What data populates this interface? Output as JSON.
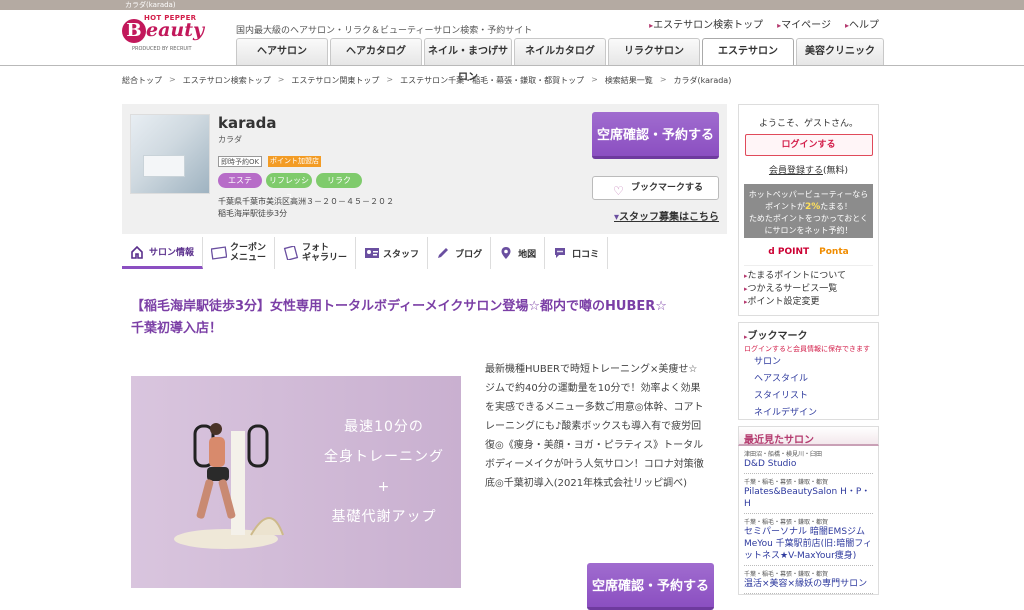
{
  "browser": {
    "title": "カラダ(karada)"
  },
  "logo": {
    "top": "HOT PEPPER",
    "main": "Beauty",
    "produced": "PRODUCED BY RECRUIT"
  },
  "header": {
    "tagline": "国内最大級のヘアサロン・リラク＆ビューティーサロン検索・予約サイト",
    "links": [
      "エステサロン検索トップ",
      "マイページ",
      "ヘルプ"
    ]
  },
  "nav": {
    "tabs": [
      "ヘアサロン",
      "ヘアカタログ",
      "ネイル・まつげサロン",
      "ネイルカタログ",
      "リラクサロン",
      "エステサロン",
      "美容クリニック"
    ],
    "active": "エステサロン"
  },
  "breadcrumb": [
    "総合トップ",
    "エステサロン検索トップ",
    "エステサロン関東トップ",
    "エステサロン千葉・稲毛・幕張・鎌取・都賀トップ",
    "検索結果一覧",
    "カラダ(karada)"
  ],
  "salon": {
    "name": "karada",
    "kana": "カラダ",
    "badges": [
      "即時予約OK",
      "ポイント加盟店"
    ],
    "genres": [
      "エステ",
      "リフレッシュ",
      "リラク"
    ],
    "address": "千葉県千葉市美浜区高洲３－２０－４５－２０２",
    "access": "稲毛海岸駅徒歩3分",
    "reserve_label": "空席確認・予約する",
    "bookmark_label": "ブックマークする",
    "staff_link": "スタッフ募集はこちら"
  },
  "salon_tabs": [
    {
      "label": "サロン情報",
      "icon": "home-icon"
    },
    {
      "label": "クーポン\nメニュー",
      "icon": "coupon-icon"
    },
    {
      "label": "フォト\nギャラリー",
      "icon": "photo-icon"
    },
    {
      "label": "スタッフ",
      "icon": "staff-icon"
    },
    {
      "label": "ブログ",
      "icon": "pen-icon"
    },
    {
      "label": "地図",
      "icon": "map-pin-icon"
    },
    {
      "label": "口コミ",
      "icon": "chat-icon"
    }
  ],
  "content": {
    "headline": "【稲毛海岸駅徒歩3分】女性専用トータルボディーメイクサロン登場☆都内で噂のHUBER☆ 千葉初導入店！",
    "hero_catch": [
      "最速10分の",
      "全身トレーニング",
      "+",
      "基礎代謝アップ"
    ],
    "description": "最新機種HUBERで時短トレーニング×美痩せ☆ジムで約40分の運動量を10分で！効率よく効果を実感できるメニュー多数ご用意◎体幹、コアトレーニングにも♪酸素ボックスも導入有で疲労回復◎《痩身・美顔・ヨガ・ピラティス》トータルボディーメイクが叶う人気サロン！コロナ対策徹底◎千葉初導入(2021年株式会社リッピ調べ)",
    "reserve_label": "空席確認・予約する"
  },
  "sidebar": {
    "welcome": "ようこそ、ゲストさん。",
    "login": "ログインする",
    "register": "会員登録する",
    "register_note": "(無料)",
    "point_line1": "ホットペッパービューティーなら",
    "point_line2a": "ポイントが",
    "point_rate": "2%",
    "point_line2b": "たまる！",
    "point_line3": "ためたポイントをつかっておとくにサロンをネット予約！",
    "dpoint": "d POINT",
    "ponta": "Ponta",
    "links": [
      "たまるポイントについて",
      "つかえるサービス一覧",
      "ポイント設定変更"
    ],
    "bookmark_title": "ブックマーク",
    "bookmark_note": "ログインすると会員情報に保存できます",
    "bookmark_items": [
      "サロン",
      "ヘアスタイル",
      "スタイリスト",
      "ネイルデザイン"
    ],
    "recent_title": "最近見たサロン",
    "recent": [
      {
        "area": "津田沼・船橋・検見川・臼田",
        "name": "D&D Studio"
      },
      {
        "area": "千葉・稲毛・幕張・鎌取・都賀",
        "name": "Pilates&BeautySalon H・P・H"
      },
      {
        "area": "千葉・稲毛・幕張・鎌取・都賀",
        "name": "セミパーソナル 暗闇EMSジム MeYou 千葉駅前店(旧:暗闇フィットネス★V-MaxYour痩身)"
      },
      {
        "area": "千葉・稲毛・幕張・鎌取・都賀",
        "name": "温活×美容×縁妖の専門サロン"
      }
    ]
  }
}
